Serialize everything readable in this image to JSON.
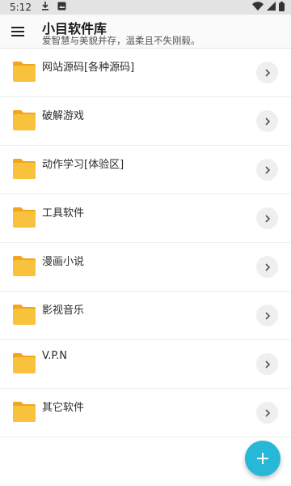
{
  "status_bar": {
    "time": "5:12",
    "icons": [
      "download-icon",
      "photo-icon",
      "wifi-icon",
      "signal-icon",
      "battery-icon"
    ]
  },
  "app_bar": {
    "title": "小目软件库",
    "subtitle": "爱智慧与美貌并存，温柔且不失刚毅。",
    "menu_icon": "menu-icon"
  },
  "items": [
    {
      "label": "网站源码[各种源码]"
    },
    {
      "label": "破解游戏"
    },
    {
      "label": "动作学习[体验区]"
    },
    {
      "label": "工具软件"
    },
    {
      "label": "漫画小说"
    },
    {
      "label": "影视音乐"
    },
    {
      "label": "V.P.N"
    },
    {
      "label": "其它软件"
    }
  ],
  "colors": {
    "accent": "#26b8d6",
    "folder": "#f9c23c",
    "folder_tab": "#f2a51d"
  },
  "fab": {
    "icon": "plus-icon"
  }
}
